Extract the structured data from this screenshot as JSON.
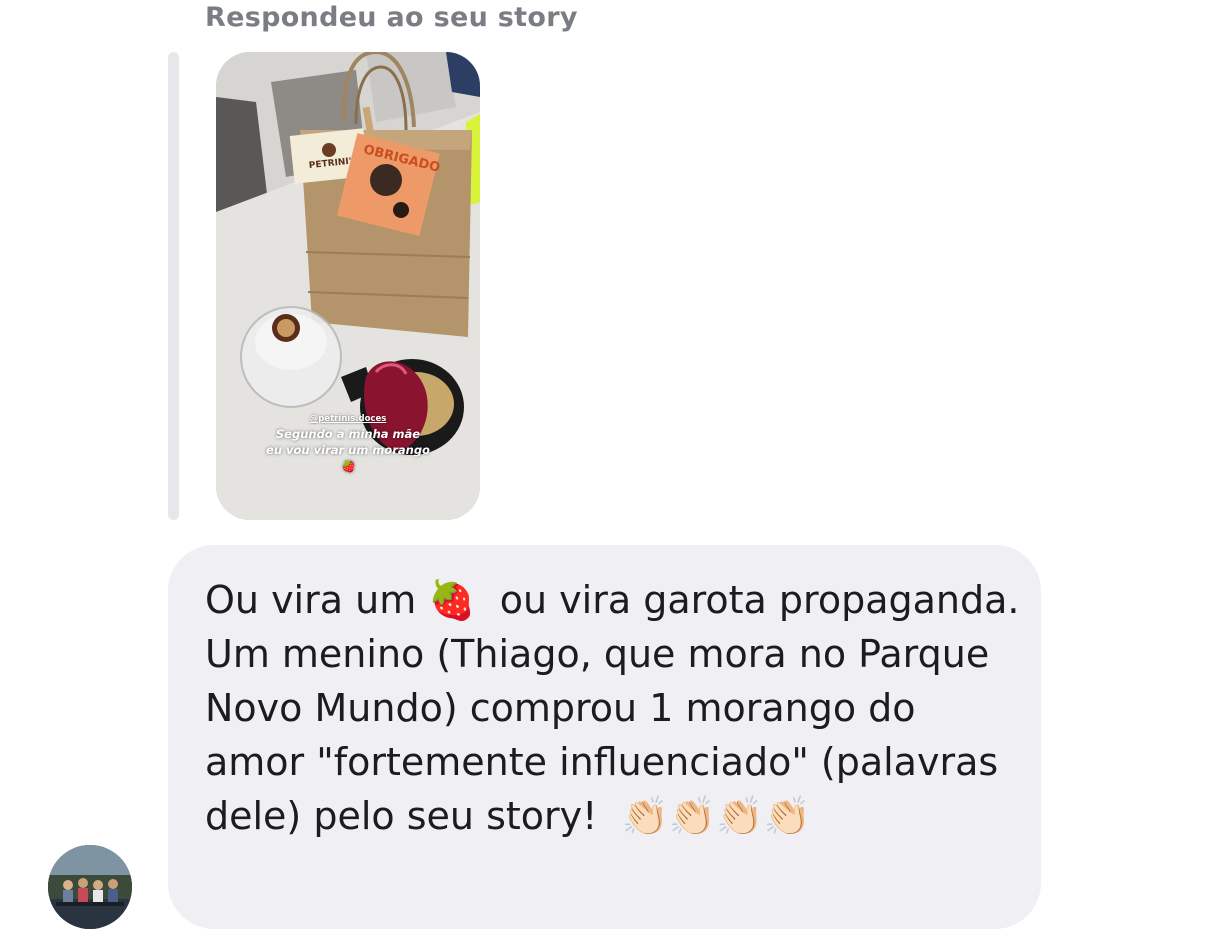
{
  "reply_header": "Respondeu ao seu story",
  "story": {
    "mention": "@petrinis.doces",
    "caption": "Segundo a minha mãe eu vou virar um morango 🍓",
    "bag_label": "PETRINI'S",
    "card_text": "OBRIGADO"
  },
  "message": {
    "text": "Ou vira um 🍓  ou vira garota propaganda. Um menino (Thiago, que mora no Parque Novo Mundo) comprou 1 morango do amor \"fortemente influenciado\" (palavras dele) pelo seu story!  👏🏻👏🏻👏🏻👏🏻"
  },
  "colors": {
    "bubble": "#efeff4",
    "header_text": "#7a7d83",
    "message_text": "#1c1c1e",
    "reply_bar": "#e6e7eb"
  },
  "icons": {
    "avatar": "group-photo-avatar"
  }
}
